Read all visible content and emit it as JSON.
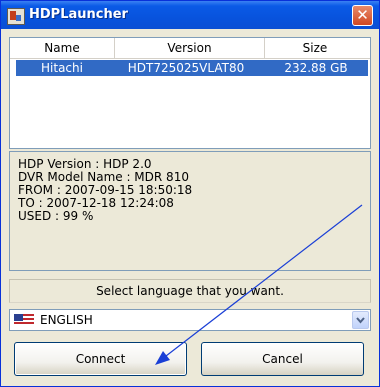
{
  "window": {
    "title": "HDPLauncher",
    "close_glyph": "✕"
  },
  "list": {
    "headers": [
      "Name",
      "Version",
      "Size"
    ],
    "rows": [
      {
        "name": "Hitachi",
        "version": "HDT725025VLAT80",
        "size": "232.88 GB",
        "selected": true
      }
    ]
  },
  "info": {
    "lines": [
      "HDP Version : HDP 2.0",
      "DVR Model Name : MDR 810",
      "FROM : 2007-09-15 18:50:18",
      "TO : 2007-12-18 12:24:08",
      "USED : 99 %"
    ]
  },
  "language": {
    "prompt": "Select language that you want.",
    "selected": "ENGLISH",
    "flag_icon": "us-flag-icon"
  },
  "buttons": {
    "connect": "Connect",
    "cancel": "Cancel"
  },
  "colors": {
    "titlebar": "#0853dd",
    "selection": "#316ac5",
    "annotation": "#1a3fd6",
    "close": "#d14822"
  }
}
